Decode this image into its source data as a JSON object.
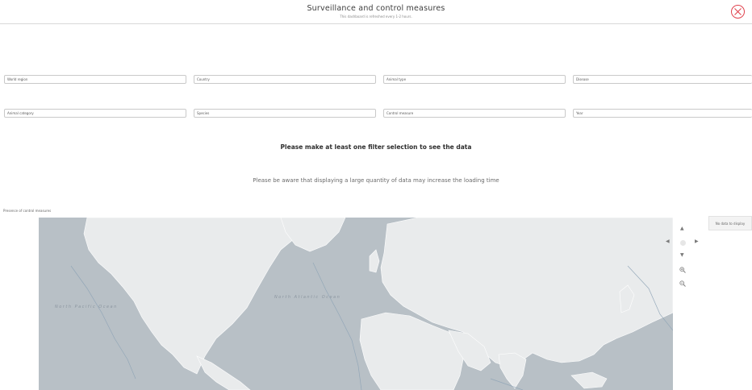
{
  "header": {
    "title": "Surveillance and control measures",
    "subtitle": "This dashboard is refreshed every 1-2 hours."
  },
  "filters": {
    "row1": [
      "World region",
      "Country",
      "Animal type",
      "Disease"
    ],
    "row2": [
      "Animal category",
      "Species",
      "Control measure",
      "Year"
    ]
  },
  "messages": {
    "selection_prompt": "Please make at least one filter selection to see the data",
    "loading_warning": "Please be aware that displaying a large quantity of data may increase the loading time"
  },
  "map": {
    "label": "Presence of control measures",
    "ocean_labels": [
      "North Pacific Ocean",
      "North Atlantic Ocean"
    ],
    "no_data": "No data to display",
    "colors": {
      "sea": "#b8c0c6",
      "land": "#e9ebec",
      "border": "#ffffff",
      "accent_close": "#e0424d"
    },
    "controls": [
      "chevron-up-icon",
      "chevron-left-icon",
      "chevron-right-icon",
      "chevron-down-icon",
      "zoom-in-icon",
      "zoom-out-icon"
    ]
  }
}
